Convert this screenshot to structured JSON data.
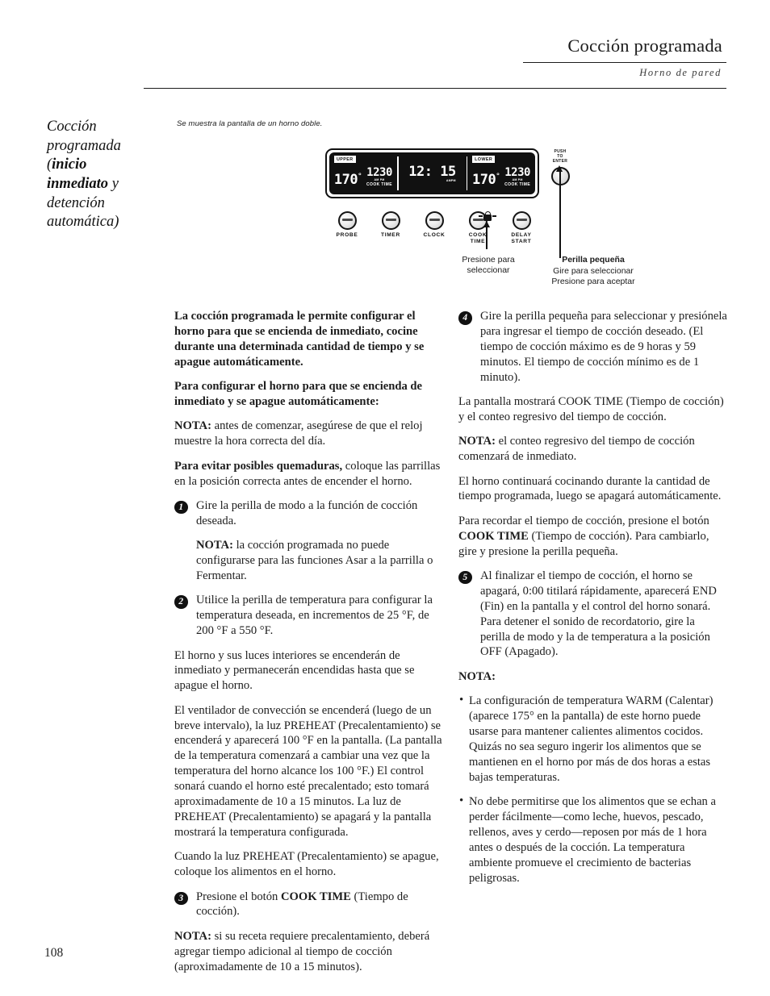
{
  "header": {
    "title": "Cocción programada",
    "subtitle": "Horno de pared"
  },
  "side_title": {
    "line1": "Cocción",
    "line2": "programada",
    "line3_open": "(",
    "line3_bold": "inicio",
    "line4_bold": "inmediato",
    "line4_rest": " y",
    "line5": "detención",
    "line6": "automática)"
  },
  "art": {
    "caption": "Se muestra la pantalla de un horno doble.",
    "lcd": {
      "upper_tag": "UPPER",
      "upper_temp": "170",
      "upper_degree": "°",
      "upper_time": "1230",
      "upper_ampm": "AM PM",
      "upper_cook_time": "COOK TIME",
      "center_time": "12: 15",
      "center_ampm": "AMPM",
      "lower_tag": "LOWER",
      "lower_temp": "170",
      "lower_degree": "°",
      "lower_time": "1230",
      "lower_ampm": "AM PM",
      "lower_cook_time": "COOK TIME"
    },
    "push_to_enter": "PUSH\nTO\nENTER",
    "buttons": [
      {
        "name": "probe",
        "label": "PROBE"
      },
      {
        "name": "timer",
        "label": "TIMER"
      },
      {
        "name": "clock",
        "label": "CLOCK"
      },
      {
        "name": "cook-time",
        "label": "COOK\nTIME"
      },
      {
        "name": "delay-start",
        "label": "DELAY\nSTART"
      }
    ],
    "callout_cook": "Presione para seleccionar",
    "callout_knob_heading": "Perilla pequeña",
    "callout_knob_line1": "Gire para seleccionar",
    "callout_knob_line2": "Presione para aceptar"
  },
  "left_column": {
    "intro_bold": "La cocción programada le permite configurar el horno para que se encienda de inmediato, cocine durante una determinada cantidad de tiempo y se apague automáticamente.",
    "purpose_bold": "Para configurar el horno para que se encienda de inmediato y se apague automáticamente:",
    "note1_label": "NOTA:",
    "note1_text": " antes de comenzar, asegúrese de que el reloj muestre la hora correcta del día.",
    "burns_label": "Para evitar posibles quemaduras,",
    "burns_text": " coloque las parrillas en la posición correcta antes de encender el horno.",
    "step1_num": "1",
    "step1_text": "Gire la perilla de modo a la función de cocción deseada.",
    "step1_note_label": "NOTA:",
    "step1_note_text": " la cocción programada no puede configurarse para las funciones Asar a la parrilla o Fermentar.",
    "step2_num": "2",
    "step2_text": "Utilice la perilla de temperatura para configurar la temperatura deseada, en incrementos de 25 °F, de 200 °F a 550 °F.",
    "step2_p1": "El horno y sus luces interiores se encenderán de inmediato y permanecerán encendidas hasta que se apague el horno.",
    "step2_p2": "El ventilador de convección se encenderá (luego de un breve intervalo), la luz PREHEAT (Precalentamiento) se encenderá y aparecerá 100 °F en la pantalla. (La pantalla de la temperatura comenzará a cambiar una vez que la temperatura del horno alcance los 100 °F.) El control sonará cuando el horno esté precalentado; esto tomará aproximadamente de 10 a 15 minutos. La luz de PREHEAT (Precalentamiento) se apagará y la pantalla mostrará la temperatura configurada.",
    "step2_p3": "Cuando la luz PREHEAT (Precalentamiento) se apague, coloque los alimentos en el horno.",
    "step3_num": "3",
    "step3_pre": "Presione el botón ",
    "step3_bold": "COOK TIME",
    "step3_post": " (Tiempo de cocción).",
    "note3_label": "NOTA:",
    "note3_text": " si su receta requiere precalentamiento, deberá agregar tiempo adicional al tiempo de cocción (aproximadamente de 10 a 15 minutos)."
  },
  "right_column": {
    "step4_num": "4",
    "step4_text": "Gire la perilla pequeña para seleccionar y presiónela para ingresar el tiempo de cocción deseado. (El tiempo de cocción máximo es de 9 horas y 59 minutos. El tiempo de cocción mínimo es de 1 minuto).",
    "p1": "La pantalla mostrará COOK TIME (Tiempo de cocción) y el conteo regresivo del tiempo de cocción.",
    "note_label": "NOTA:",
    "note_text": " el conteo regresivo del tiempo de cocción comenzará de inmediato.",
    "p2": "El horno continuará cocinando durante la cantidad de tiempo programada, luego se apagará automáticamente.",
    "p3_pre": "Para recordar el tiempo de cocción, presione el botón ",
    "p3_bold": "COOK TIME",
    "p3_post": " (Tiempo de cocción). Para cambiarlo, gire y presione la perilla pequeña.",
    "step5_num": "5",
    "step5_text": "Al finalizar el tiempo de cocción, el horno se apagará, 0:00 titilará rápidamente, aparecerá END (Fin) en la pantalla y el control del horno sonará. Para detener el sonido de recordatorio, gire la perilla de modo y la de temperatura a la posición OFF (Apagado).",
    "note_heading": "NOTA:",
    "bullet1": "La configuración de temperatura WARM (Calentar) (aparece 175° en la pantalla) de este horno puede usarse para mantener calientes alimentos cocidos. Quizás no sea seguro ingerir los alimentos que se mantienen en el horno por más de dos horas a estas bajas temperaturas.",
    "bullet2": "No debe permitirse que los alimentos que se echan a perder fácilmente—como leche, huevos, pescado, rellenos, aves y cerdo—reposen por más de 1 hora antes o después de la cocción. La temperatura ambiente promueve el crecimiento de bacterias peligrosas.",
    "bullet_mark": "•"
  },
  "page_number": "108"
}
